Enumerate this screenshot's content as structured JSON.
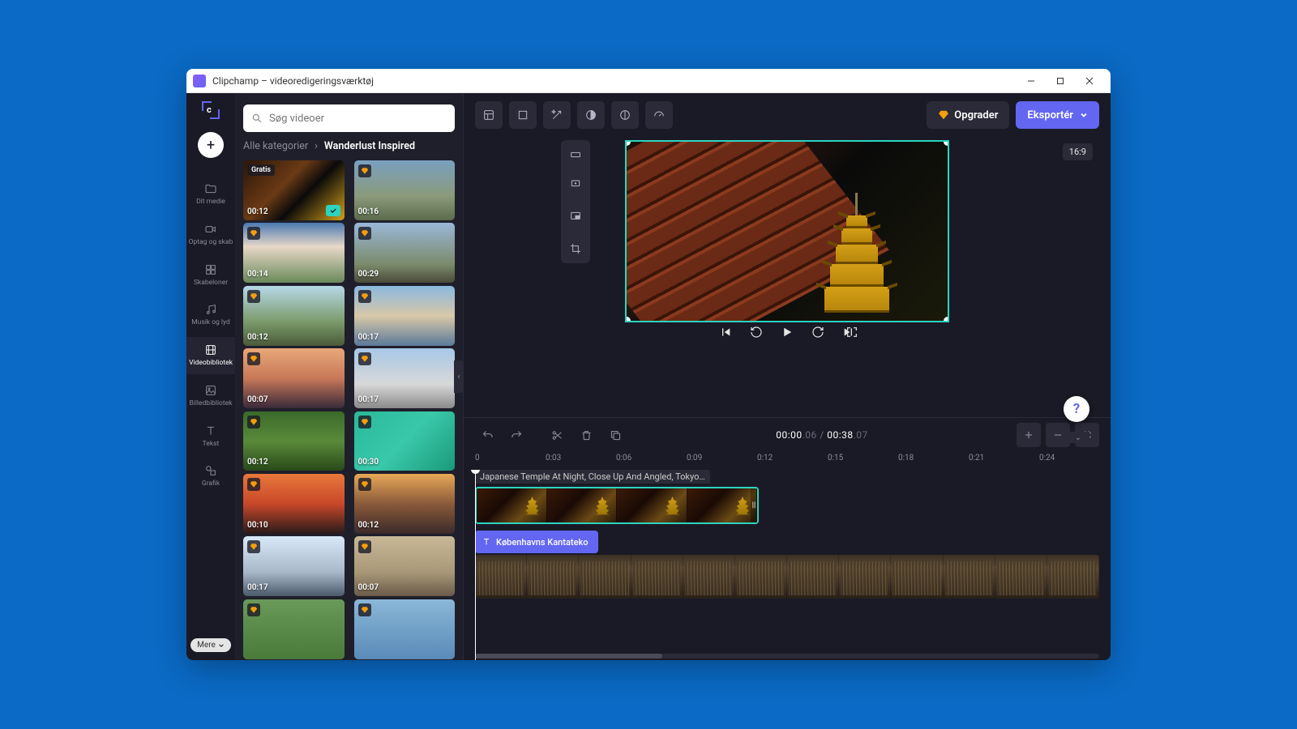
{
  "window": {
    "title": "Clipchamp – videoredigeringsværktøj"
  },
  "rail": {
    "items": [
      {
        "label": "Dit medie"
      },
      {
        "label": "Optag og skab"
      },
      {
        "label": "Skabeloner"
      },
      {
        "label": "Musik og lyd"
      },
      {
        "label": "Videobibliotek"
      },
      {
        "label": "Billedbibliotek"
      },
      {
        "label": "Tekst"
      },
      {
        "label": "Grafik"
      }
    ],
    "more": "Mere"
  },
  "library": {
    "search_placeholder": "Søg videoer",
    "breadcrumb_root": "Alle kategorier",
    "breadcrumb_current": "Wanderlust Inspired",
    "thumbs": [
      {
        "duration": "00:12",
        "free_label": "Gratis",
        "selected": true
      },
      {
        "duration": "00:16",
        "premium": true
      },
      {
        "duration": "00:14",
        "premium": true
      },
      {
        "duration": "00:29",
        "premium": true
      },
      {
        "duration": "00:12",
        "premium": true
      },
      {
        "duration": "00:17",
        "premium": true
      },
      {
        "duration": "00:07",
        "premium": true
      },
      {
        "duration": "00:17",
        "premium": true
      },
      {
        "duration": "00:12",
        "premium": true
      },
      {
        "duration": "00:30",
        "premium": true
      },
      {
        "duration": "00:10",
        "premium": true
      },
      {
        "duration": "00:12",
        "premium": true
      },
      {
        "duration": "00:17",
        "premium": true
      },
      {
        "duration": "00:07",
        "premium": true
      },
      {
        "duration": "",
        "premium": true
      },
      {
        "duration": "",
        "premium": true
      }
    ]
  },
  "topbar": {
    "upgrade": "Opgrader",
    "export": "Eksportér"
  },
  "preview": {
    "aspect": "16:9"
  },
  "timeline": {
    "time_current": "00:00",
    "time_current_frac": ".06",
    "time_total": "00:38",
    "time_total_frac": ".07",
    "ruler": [
      "0",
      "0:03",
      "0:06",
      "0:09",
      "0:12",
      "0:15",
      "0:18",
      "0:21",
      "0:24"
    ],
    "clip1_label": "Japanese Temple At Night, Close Up And Angled, Tokyo, ...",
    "clip2_label": "Københavns Kantateko"
  },
  "colors": {
    "accent": "#6366f1",
    "teal": "#2dd4bf",
    "gold": "#f59e0b"
  }
}
